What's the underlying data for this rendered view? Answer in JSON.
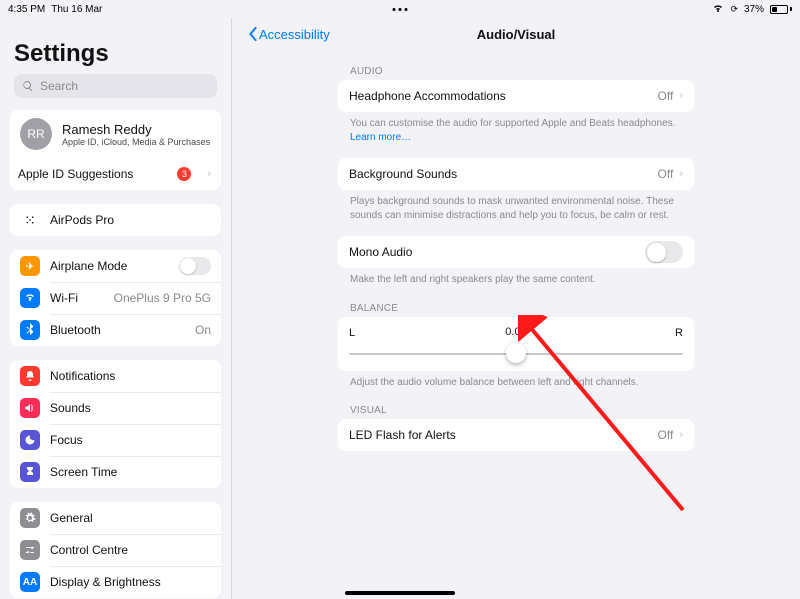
{
  "status": {
    "time": "4:35 PM",
    "date": "Thu 16 Mar",
    "battery": "37%"
  },
  "sidebar": {
    "title": "Settings",
    "searchPlaceholder": "Search",
    "profile": {
      "initials": "RR",
      "name": "Ramesh Reddy",
      "sub": "Apple ID, iCloud, Media & Purchases"
    },
    "suggestRow": {
      "label": "Apple ID Suggestions",
      "badge": "3"
    },
    "airpods": "AirPods Pro",
    "net": [
      {
        "label": "Airplane Mode",
        "value": ""
      },
      {
        "label": "Wi-Fi",
        "value": "OnePlus 9 Pro 5G"
      },
      {
        "label": "Bluetooth",
        "value": "On"
      }
    ],
    "ctl": [
      {
        "label": "Notifications"
      },
      {
        "label": "Sounds"
      },
      {
        "label": "Focus"
      },
      {
        "label": "Screen Time"
      }
    ],
    "gen": [
      {
        "label": "General"
      },
      {
        "label": "Control Centre"
      },
      {
        "label": "Display & Brightness"
      }
    ]
  },
  "detail": {
    "back": "Accessibility",
    "title": "Audio/Visual",
    "audioLabel": "AUDIO",
    "balanceLabel": "BALANCE",
    "visualLabel": "VISUAL",
    "headphone": {
      "label": "Headphone Accommodations",
      "value": "Off",
      "help": "You can customise the audio for supported Apple and Beats headphones. ",
      "link": "Learn more…"
    },
    "bg": {
      "label": "Background Sounds",
      "value": "Off",
      "help": "Plays background sounds to mask unwanted environmental noise. These sounds can minimise distractions and help you to focus, be calm or rest."
    },
    "mono": {
      "label": "Mono Audio",
      "help": "Make the left and right speakers play the same content."
    },
    "balance": {
      "left": "L",
      "right": "R",
      "value": "0.00",
      "help": "Adjust the audio volume balance between left and right channels."
    },
    "led": {
      "label": "LED Flash for Alerts",
      "value": "Off"
    }
  }
}
